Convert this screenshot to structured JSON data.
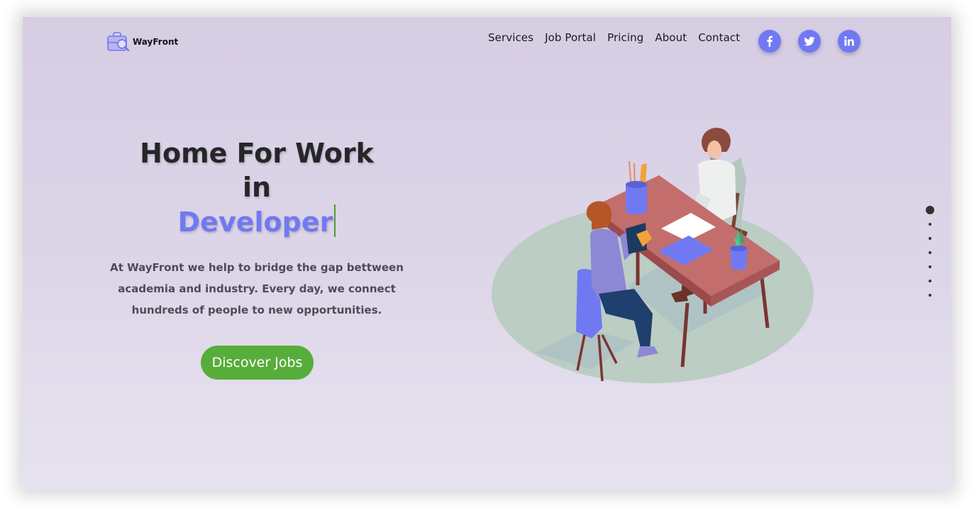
{
  "header": {
    "brand": "WayFront",
    "logo_icon": "briefcase-magnifier-icon",
    "nav": [
      "Services",
      "Job Portal",
      "Pricing",
      "About",
      "Contact"
    ],
    "social": [
      {
        "name": "facebook",
        "icon": "facebook-icon"
      },
      {
        "name": "twitter",
        "icon": "twitter-icon"
      },
      {
        "name": "linkedin",
        "icon": "linkedin-icon"
      }
    ]
  },
  "hero": {
    "line1": "Home For Work",
    "line2": "in",
    "role": "Developer",
    "description": "At WayFront we help to bridge the gap betweenacademia and industry. Every day, we connect hundreds of people to new opportunities.",
    "description_lines": [
      "At WayFront we help to bridge the gap bettween",
      "academia and industry. Every day, we connect",
      "hundreds of people to new opportunities."
    ],
    "cta_label": "Discover Jobs"
  },
  "slider": {
    "count": 7,
    "active_index": 0
  },
  "colors": {
    "accent": "#7179f2",
    "cta": "#57ad3a",
    "caret": "#4e9d35",
    "background_top": "#d6cde3",
    "background_bottom": "#e8e3f0",
    "heading": "#262629"
  }
}
